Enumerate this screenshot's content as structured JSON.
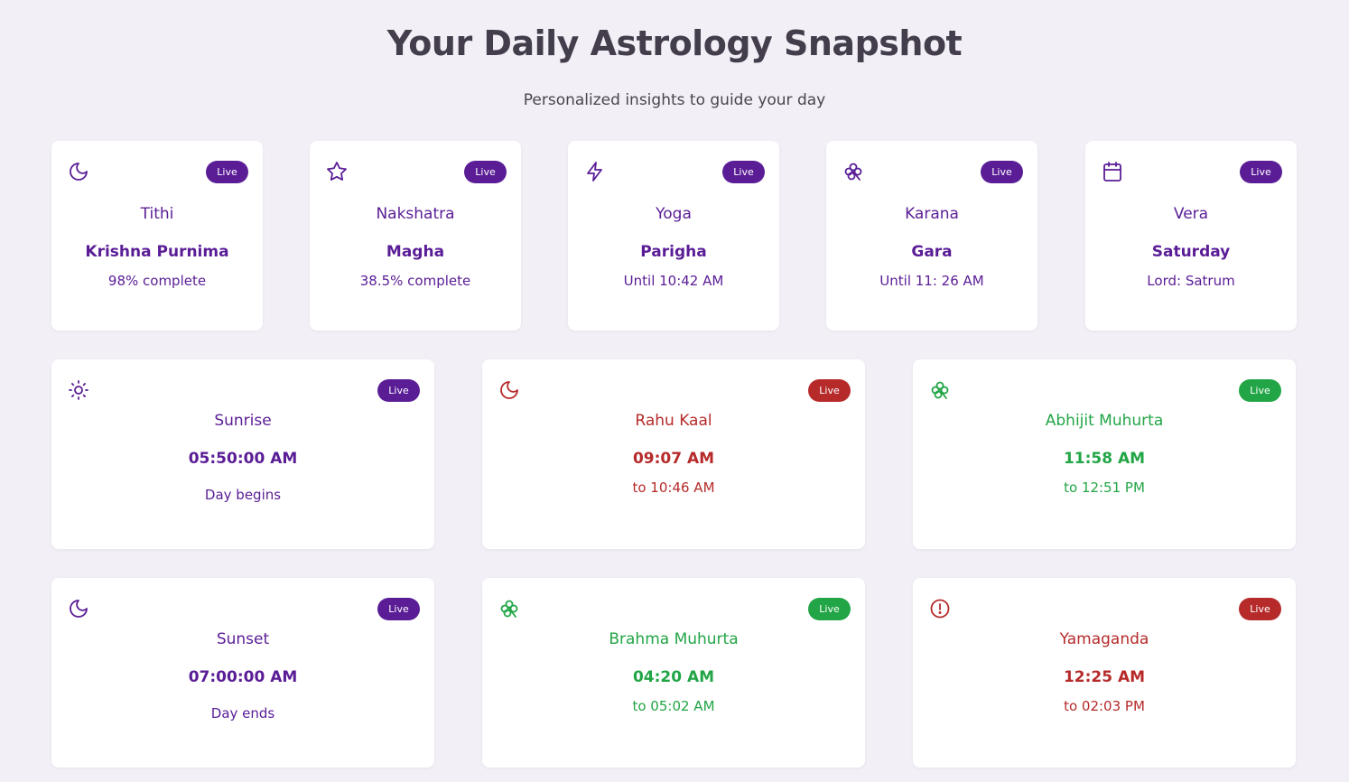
{
  "header": {
    "title": "Your Daily Astrology Snapshot",
    "subtitle": "Personalized insights to guide your day"
  },
  "colors": {
    "purple": "#5a1d96",
    "red": "#b62a2a",
    "green": "#22a546",
    "background": "#f2eff6"
  },
  "panchang": [
    {
      "icon": "moon-icon",
      "badge": "Live",
      "label": "Tithi",
      "value": "Krishna Purnima",
      "sub": "98% complete"
    },
    {
      "icon": "star-icon",
      "badge": "Live",
      "label": "Nakshatra",
      "value": "Magha",
      "sub": "38.5% complete"
    },
    {
      "icon": "lightning-icon",
      "badge": "Live",
      "label": "Yoga",
      "value": "Parigha",
      "sub": "Until 10:42 AM"
    },
    {
      "icon": "clover-icon",
      "badge": "Live",
      "label": "Karana",
      "value": "Gara",
      "sub": "Until 11: 26 AM"
    },
    {
      "icon": "calendar-icon",
      "badge": "Live",
      "label": "Vera",
      "value": "Saturday",
      "sub": "Lord: Satrum"
    }
  ],
  "timings": [
    {
      "icon": "sun-icon",
      "badge": "Live",
      "label": "Sunrise",
      "value": "05:50:00 AM",
      "sub": "Day begins",
      "tone": "purple"
    },
    {
      "icon": "moon-icon",
      "badge": "Live",
      "label": "Rahu Kaal",
      "value": "09:07 AM",
      "sub": "to 10:46 AM",
      "tone": "red"
    },
    {
      "icon": "clover-icon",
      "badge": "Live",
      "label": "Abhijit Muhurta",
      "value": "11:58 AM",
      "sub": "to 12:51 PM",
      "tone": "green"
    },
    {
      "icon": "moon-icon",
      "badge": "Live",
      "label": "Sunset",
      "value": "07:00:00 AM",
      "sub": "Day ends",
      "tone": "purple"
    },
    {
      "icon": "clover-icon",
      "badge": "Live",
      "label": "Brahma Muhurta",
      "value": "04:20 AM",
      "sub": "to 05:02 AM",
      "tone": "green"
    },
    {
      "icon": "alert-circle-icon",
      "badge": "Live",
      "label": "Yamaganda",
      "value": "12:25 AM",
      "sub": "to 02:03 PM",
      "tone": "red"
    }
  ]
}
